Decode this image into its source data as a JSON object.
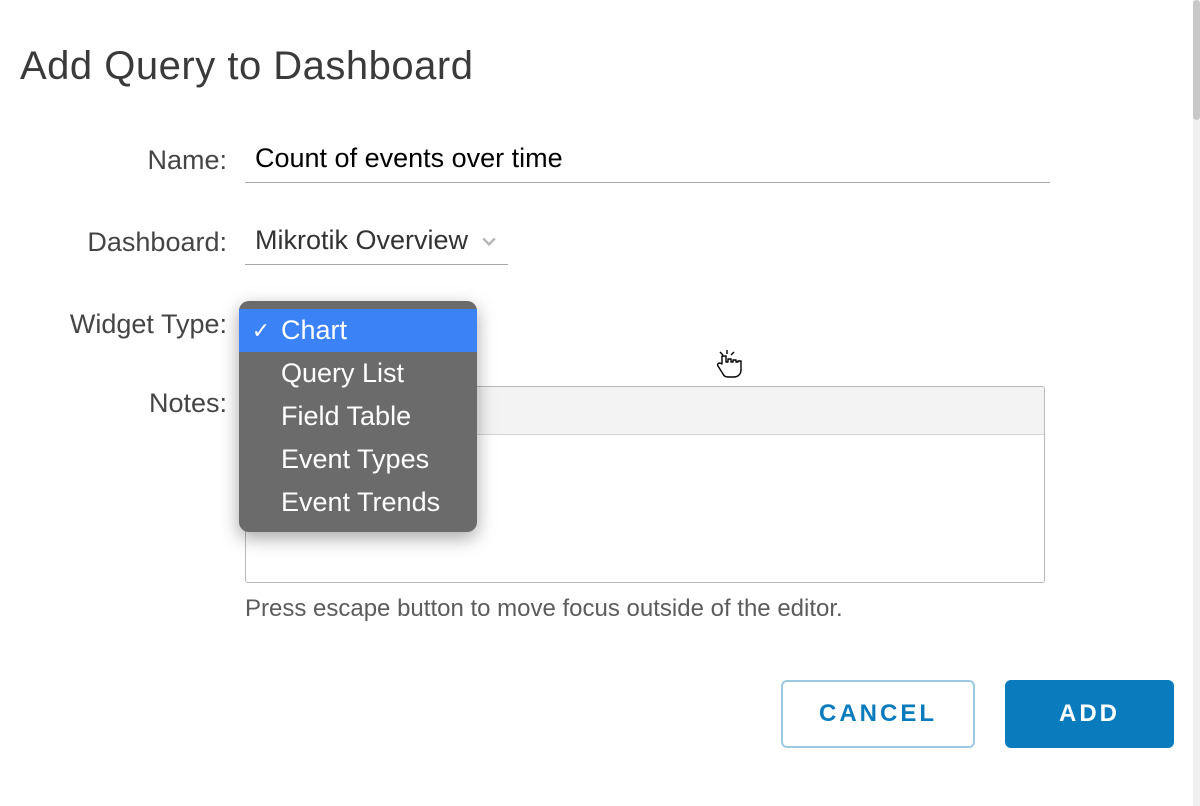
{
  "dialog": {
    "title": "Add Query to Dashboard",
    "labels": {
      "name": "Name:",
      "dashboard": "Dashboard:",
      "widget_type": "Widget Type:",
      "notes": "Notes:"
    },
    "fields": {
      "name_value": "Count of events over time",
      "dashboard_value": "Mikrotik Overview",
      "widget_type_value": "Chart",
      "notes_value": ""
    },
    "widget_type_options": [
      "Chart",
      "Query List",
      "Field Table",
      "Event Types",
      "Event Trends"
    ],
    "notes_hint": "Press escape button to move focus outside of the editor.",
    "selected_widget_index": 0
  },
  "actions": {
    "cancel_label": "CANCEL",
    "add_label": "ADD"
  },
  "icons": {
    "check": "✓"
  }
}
